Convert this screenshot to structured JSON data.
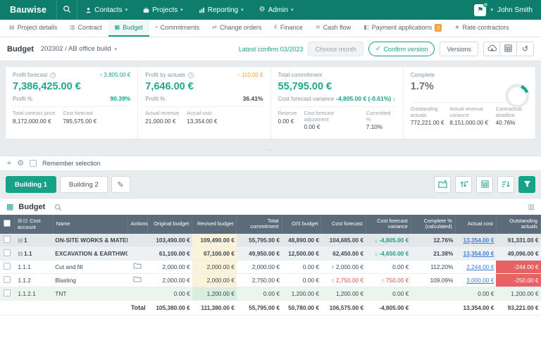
{
  "topbar": {
    "brand": "Bauwise",
    "menus": [
      {
        "name": "contacts",
        "label": "Contacts",
        "icon": "person"
      },
      {
        "name": "projects",
        "label": "Projects",
        "icon": "briefcase"
      },
      {
        "name": "reporting",
        "label": "Reporting",
        "icon": "chart"
      },
      {
        "name": "admin",
        "label": "Admin",
        "icon": "gear"
      }
    ],
    "user": "John Smith"
  },
  "project_tabs": [
    {
      "name": "project-details",
      "label": "Project details",
      "icon": "▤"
    },
    {
      "name": "contract",
      "label": "Contract",
      "icon": "▥"
    },
    {
      "name": "budget",
      "label": "Budget",
      "icon": "▦",
      "active": true
    },
    {
      "name": "commitments",
      "label": "Commitments",
      "icon": "▪"
    },
    {
      "name": "change-orders",
      "label": "Change orders",
      "icon": "⇄"
    },
    {
      "name": "finance",
      "label": "Finance",
      "icon": "€"
    },
    {
      "name": "cash-flow",
      "label": "Cash flow",
      "icon": "≋"
    },
    {
      "name": "payment-applications",
      "label": "Payment applications",
      "icon": "◧",
      "badge": "2"
    },
    {
      "name": "rate-contractors",
      "label": "Rate contractors",
      "icon": "★"
    }
  ],
  "budget_bar": {
    "label": "Budget",
    "project": "202302 / AB office build",
    "latest_confirm": "Latest confirm 03/2023",
    "choose_month": "Choose month",
    "confirm_version": "Confirm version",
    "versions": "Versions"
  },
  "kpis": {
    "profit_forecast": {
      "title": "Profit forecast",
      "delta": "↑ 3,805.00 €",
      "value": "7,386,425.00 €",
      "sub_label": "Profit %",
      "sub_value": "90.39%",
      "stats": [
        {
          "label": "Total contract price",
          "value": "8,172,000.00 €"
        },
        {
          "label": "Cost forecast",
          "value": "785,575.00 €"
        }
      ]
    },
    "profit_by_actuals": {
      "title": "Profit by actuals",
      "delta": "↑ 110.00 €",
      "value": "7,646.00 €",
      "sub_label": "Profit %",
      "sub_value": "36.41%",
      "stats": [
        {
          "label": "Actual revenue",
          "value": "21,000.00 €"
        },
        {
          "label": "Actual cost",
          "value": "13,354.00 €"
        }
      ]
    },
    "total_commitment": {
      "title": "Total commitment",
      "value": "55,795.00 €",
      "sub_label": "Cost forecast variance",
      "sub_value": "-4,805.00 € (-0.61%) ↓",
      "stats": [
        {
          "label": "Reserve",
          "value": "0.00 €"
        },
        {
          "label": "Cost forecast adjustment",
          "value": "0.00 €"
        },
        {
          "label": "Committed %",
          "value": "7.10%"
        }
      ]
    },
    "complete": {
      "title": "Complete",
      "value": "1.7%",
      "donut_percent": 13,
      "stats": [
        {
          "label": "Outstanding actuals",
          "value": "772,221.00 €"
        },
        {
          "label": "Actual revenue variance",
          "value": "8,151,000.00 €"
        },
        {
          "label": "Contractual deadline",
          "value": "40.76%"
        }
      ]
    }
  },
  "selection_bar": {
    "remember_label": "Remember selection"
  },
  "building_bar": {
    "tabs": [
      {
        "name": "building-1",
        "label": "Building 1",
        "active": true
      },
      {
        "name": "building-2",
        "label": "Building 2"
      }
    ]
  },
  "budget_table": {
    "title": "Budget",
    "columns": [
      "Cost account",
      "Name",
      "Actions",
      "Original budget",
      "Revised budget",
      "Total commitment",
      "O/S budget",
      "Cost forecast",
      "Cost forecast variance",
      "Complete % (calculated)",
      "Actual cost",
      "Outstanding actuals"
    ],
    "rows": [
      {
        "account": "1",
        "name": "ON-SITE WORKS & MATERIALS",
        "type": "group1",
        "action": false,
        "cells": [
          {
            "t": "103,490.00 €"
          },
          {
            "t": "109,490.00 €",
            "s": "y"
          },
          {
            "t": "55,795.00 €"
          },
          {
            "t": "48,890.00 €"
          },
          {
            "t": "104,685.00 €"
          },
          {
            "t": "↓ -4,805.00 €",
            "s": "t"
          },
          {
            "t": "12.76%"
          },
          {
            "t": "13,354.00 €",
            "s": "l"
          },
          {
            "t": "91,331.00 €"
          }
        ]
      },
      {
        "account": "1.1",
        "name": "EXCAVATION & EARTHWORK",
        "type": "group2",
        "action": false,
        "cells": [
          {
            "t": "61,100.00 €"
          },
          {
            "t": "67,100.00 €",
            "s": "y"
          },
          {
            "t": "49,950.00 €"
          },
          {
            "t": "12,500.00 €"
          },
          {
            "t": "62,450.00 €"
          },
          {
            "t": "↓ -4,650.00 €",
            "s": "t"
          },
          {
            "t": "21.38%"
          },
          {
            "t": "13,354.00 €",
            "s": "l"
          },
          {
            "t": "49,096.00 €"
          }
        ]
      },
      {
        "account": "1.1.1",
        "name": "Cut and fill",
        "type": "normal",
        "action": true,
        "cells": [
          {
            "t": "2,000.00 €"
          },
          {
            "t": "2,000.00 €",
            "s": "y"
          },
          {
            "t": "2,000.00 €"
          },
          {
            "t": "0.00 €"
          },
          {
            "t": "↑ 2,000.00 €"
          },
          {
            "t": "0.00 €"
          },
          {
            "t": "112.20%"
          },
          {
            "t": "2,244.00 €",
            "s": "l"
          },
          {
            "t": "-244.00 €",
            "s": "rb"
          }
        ]
      },
      {
        "account": "1.1.2",
        "name": "Blasting",
        "type": "normal",
        "action": true,
        "cells": [
          {
            "t": "2,000.00 €"
          },
          {
            "t": "2,000.00 €",
            "s": "y"
          },
          {
            "t": "2,750.00 €"
          },
          {
            "t": "0.00 €"
          },
          {
            "t": "↑ 2,750.00 €",
            "s": "r"
          },
          {
            "t": "↑ 750.00 €",
            "s": "r"
          },
          {
            "t": "109.09%"
          },
          {
            "t": "3,000.00 €",
            "s": "l"
          },
          {
            "t": "-250.00 €",
            "s": "rb"
          }
        ]
      },
      {
        "account": "1.1.2.1",
        "name": "TNT",
        "type": "green",
        "action": false,
        "cells": [
          {
            "t": "0.00 €"
          },
          {
            "t": "1,200.00 €",
            "s": "g"
          },
          {
            "t": "0.00 €"
          },
          {
            "t": "1,200.00 €"
          },
          {
            "t": "1,200.00 €"
          },
          {
            "t": "0.00 €"
          },
          {
            "t": ""
          },
          {
            "t": "0.00 €"
          },
          {
            "t": "1,200.00 €"
          }
        ]
      }
    ],
    "total": {
      "label": "Total",
      "cells": [
        "105,380.00 €",
        "111,380.00 €",
        "55,795.00 €",
        "50,780.00 €",
        "106,575.00 €",
        "-4,805.00 €",
        "",
        "13,354.00 €",
        "93,221.00 €"
      ]
    }
  }
}
